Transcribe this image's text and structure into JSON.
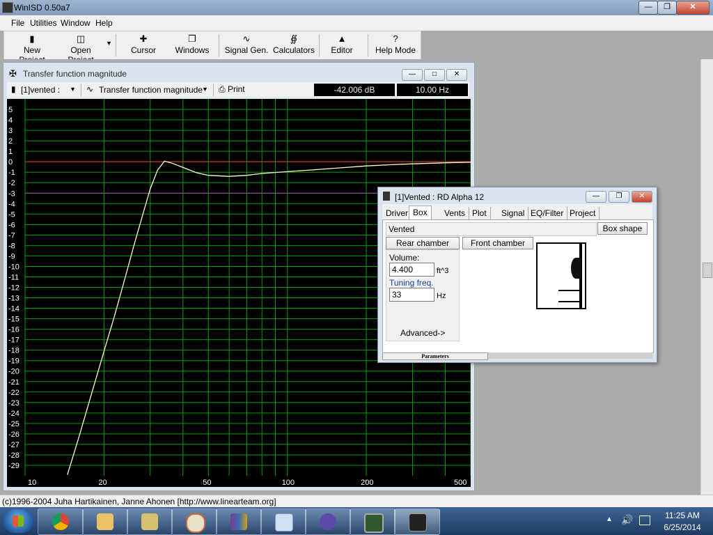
{
  "app": {
    "title": "WinISD 0.50a7"
  },
  "menu": {
    "items": [
      "File",
      "Utilities",
      "Window",
      "Help"
    ]
  },
  "toolbar": {
    "new_project": "New Project",
    "open_project": "Open Project",
    "cursor": "Cursor",
    "windows": "Windows",
    "signal_gen": "Signal Gen.",
    "calculators": "Calculators",
    "editor": "Editor",
    "help_mode": "Help Mode"
  },
  "tf_window": {
    "title": "Transfer function magnitude",
    "project_select": "[1]vented :",
    "plot_select": "Transfer function magnitude",
    "print": "Print",
    "readout_db": "-42.006 dB",
    "readout_hz": "10.00 Hz"
  },
  "chart_data": {
    "type": "line",
    "x_scale": "log",
    "xlim": [
      10,
      500
    ],
    "ylim": [
      -30,
      6
    ],
    "y_ticks": [
      5,
      4,
      3,
      2,
      1,
      0,
      -1,
      -2,
      -3,
      -4,
      -5,
      -6,
      -7,
      -8,
      -9,
      -10,
      -11,
      -12,
      -13,
      -14,
      -15,
      -16,
      -17,
      -18,
      -19,
      -20,
      -21,
      -22,
      -23,
      -24,
      -25,
      -26,
      -27,
      -28,
      -29
    ],
    "x_tick_labels": [
      10,
      20,
      50,
      100,
      200,
      500
    ],
    "x_minor": [
      30,
      40,
      60,
      70,
      80,
      90,
      300,
      400
    ],
    "reference_lines": [
      {
        "y": 0,
        "color": "#ff2a2a"
      },
      {
        "y": -3,
        "color": "#b43cb4"
      }
    ],
    "grid": true,
    "line_color": "#ffffc8",
    "series": [
      {
        "x": [
          14.5,
          16,
          18,
          20,
          22,
          24,
          26,
          28,
          30,
          32,
          34,
          36,
          40,
          45,
          50,
          60,
          70,
          80,
          100,
          130,
          160,
          200,
          250,
          300,
          400,
          500
        ],
        "y": [
          -29.9,
          -26.4,
          -22.0,
          -18.1,
          -14.6,
          -11.2,
          -8.0,
          -5.2,
          -2.6,
          -0.8,
          0.05,
          -0.1,
          -0.55,
          -1.05,
          -1.3,
          -1.4,
          -1.3,
          -1.12,
          -0.95,
          -0.75,
          -0.58,
          -0.4,
          -0.28,
          -0.2,
          -0.1,
          -0.05
        ]
      }
    ]
  },
  "vented_dialog": {
    "title": "[1]Vented : RD Alpha 12",
    "tabs": [
      "Driver",
      "Box",
      "Vents",
      "Plot",
      "Signal",
      "EQ/Filter",
      "Project"
    ],
    "active_tab": "Box",
    "box_type": "Vented",
    "box_shape_button": "Box shape",
    "rear_chamber_button": "Rear chamber",
    "front_chamber_button": "Front chamber",
    "volume_label": "Volume:",
    "volume_value": "4.400",
    "volume_unit": "ft^3",
    "tuning_label": "Tuning freq.",
    "tuning_value": "33",
    "tuning_unit": "Hz",
    "advanced_button": "Advanced->",
    "parameters_label": "Parameters"
  },
  "status": {
    "text": "(c)1996-2004 Juha Hartikainen, Janne Ahonen [http://www.linearteam.org]"
  },
  "taskbar": {
    "time": "11:25 AM",
    "date": "6/25/2014",
    "apps": [
      "chrome-icon",
      "explorer-icon",
      "folder-icon",
      "paint-icon",
      "winrar-icon",
      "remote-icon",
      "bittorrent-icon",
      "display-icon",
      "winisd-icon"
    ]
  }
}
